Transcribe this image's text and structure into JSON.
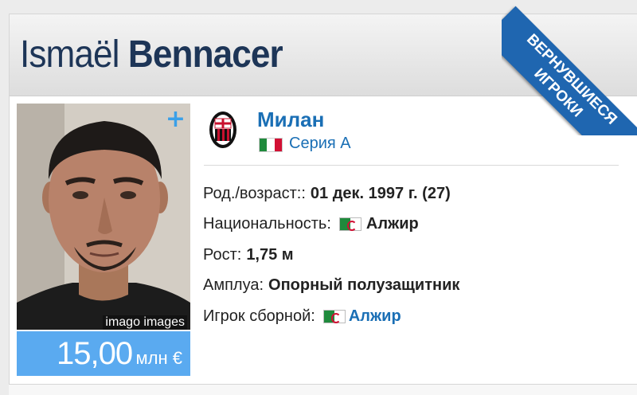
{
  "player": {
    "first_name": "Ismaël",
    "last_name": "Bennacer"
  },
  "ribbon": {
    "line1": "ВЕРНУВШИЕСЯ",
    "line2": "ИГРОКИ",
    "color": "#1f66b0"
  },
  "photo": {
    "credit": "imago images",
    "expand_icon": "plus-icon"
  },
  "market_value": {
    "amount": "15,00",
    "unit": "млн €"
  },
  "club": {
    "name": "Милан",
    "league": "Серия А",
    "crest_icon": "ac-milan-crest",
    "league_flag": "italy-flag"
  },
  "details": {
    "birth_label": "Род./возраст::",
    "birth_value": "01 дек. 1997 г. (27)",
    "nationality_label": "Национальность:",
    "nationality_value": "Алжир",
    "height_label": "Рост:",
    "height_value": "1,75 м",
    "position_label": "Амплуа:",
    "position_value": "Опорный полузащитник",
    "national_team_label": "Игрок сборной:",
    "national_team_value": "Алжир"
  },
  "colors": {
    "accent": "#1a6fb5",
    "value_box": "#5aaaf0",
    "name": "#1d3557"
  }
}
